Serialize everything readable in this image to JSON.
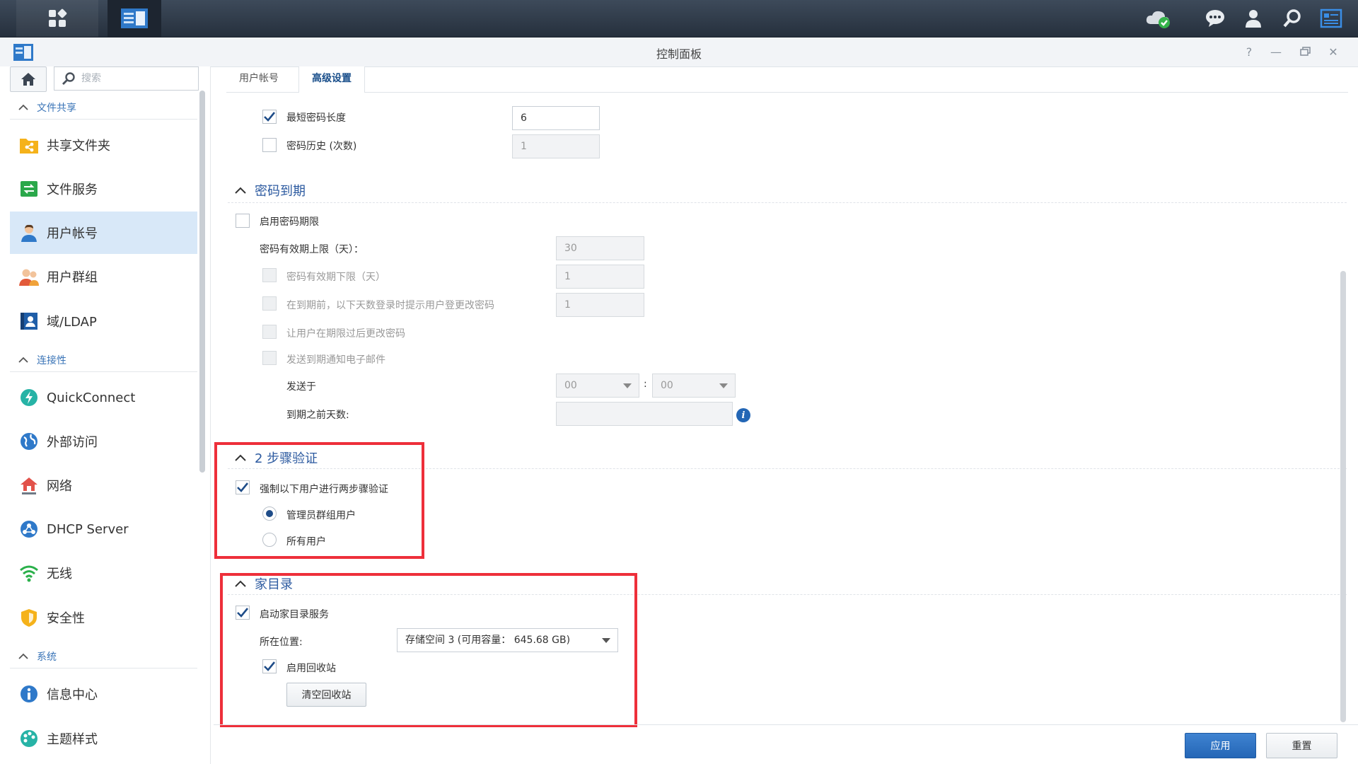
{
  "window": {
    "title": "控制面板"
  },
  "taskbar": {
    "colors": {
      "bg": "#2b3440",
      "accent": "#2f79c9"
    }
  },
  "sidebar": {
    "search_placeholder": "搜索",
    "sections": [
      {
        "label": "文件共享"
      },
      {
        "label": "连接性"
      },
      {
        "label": "系统"
      }
    ],
    "items": [
      {
        "label": "共享文件夹",
        "icon": "shared-folder-icon"
      },
      {
        "label": "文件服务",
        "icon": "file-services-icon"
      },
      {
        "label": "用户帐号",
        "icon": "user-account-icon",
        "active": true
      },
      {
        "label": "用户群组",
        "icon": "user-group-icon"
      },
      {
        "label": "域/LDAP",
        "icon": "domain-ldap-icon"
      },
      {
        "label": "QuickConnect",
        "icon": "quickconnect-icon"
      },
      {
        "label": "外部访问",
        "icon": "external-access-icon"
      },
      {
        "label": "网络",
        "icon": "network-icon"
      },
      {
        "label": "DHCP Server",
        "icon": "dhcp-server-icon"
      },
      {
        "label": "无线",
        "icon": "wireless-icon"
      },
      {
        "label": "安全性",
        "icon": "security-icon"
      },
      {
        "label": "信息中心",
        "icon": "info-center-icon"
      },
      {
        "label": "主题样式",
        "icon": "theme-icon"
      }
    ]
  },
  "tabs": [
    {
      "label": "用户帐号"
    },
    {
      "label": "高级设置",
      "active": true
    }
  ],
  "password_rules": {
    "min_length": {
      "label": "最短密码长度",
      "checked": true,
      "value": "6"
    },
    "history": {
      "label": "密码历史 (次数)",
      "checked": false,
      "value": "1"
    }
  },
  "expiry": {
    "title": "密码到期",
    "enable_label": "启用密码期限",
    "max_days_label": "密码有效期上限（天）：",
    "max_days_value": "30",
    "min_days_label": "密码有效期下限（天）",
    "min_days_value": "1",
    "notify_label": "在到期前，以下天数登录时提示用户登更改密码",
    "notify_value": "1",
    "allow_change_label": "让用户在期限过后更改密码",
    "send_email_label": "发送到期通知电子邮件",
    "send_at_label": "发送于",
    "hour_value": "00",
    "minute_value": "00",
    "time_sep": ":",
    "days_before_label": "到期之前天数:",
    "days_before_value": ""
  },
  "two_step": {
    "title": "2 步骤验证",
    "enforce_label": "强制以下用户进行两步骤验证",
    "option_admin": "管理员群组用户",
    "option_all": "所有用户",
    "selected": "admin"
  },
  "home": {
    "title": "家目录",
    "enable_label": "启动家目录服务",
    "location_label": "所在位置:",
    "location_value": "存储空间 3 (可用容量： 645.68 GB)",
    "recycle_label": "启用回收站",
    "empty_recycle_label": "清空回收站"
  },
  "footer": {
    "apply_label": "应用",
    "reset_label": "重置"
  },
  "highlight_color": "#ee2f3a"
}
